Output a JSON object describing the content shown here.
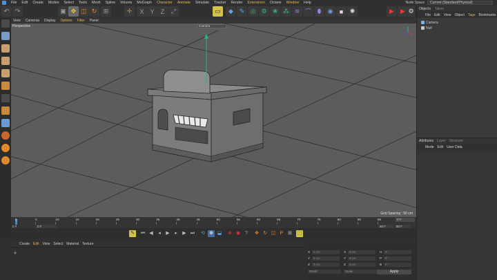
{
  "menubar": {
    "items": [
      "File",
      "Edit",
      "Create",
      "Modes",
      "Select",
      "Tools",
      "Mesh",
      "Spline",
      "Volume",
      "MoGraph",
      "Character",
      "Animate",
      "Simulate",
      "Tracker",
      "Render",
      "Extensions",
      "Octane",
      "Window",
      "Help"
    ],
    "node_space_label": "Node Space",
    "node_space_value": "Current (Standard/Physical)"
  },
  "viewport": {
    "menu": [
      "View",
      "Cameras",
      "Display",
      "Options",
      "Filter",
      "Panel"
    ],
    "label": "Perspective",
    "camera": "Camera",
    "grid_spacing": "Grid Spacing : 50 cm"
  },
  "timeline": {
    "ticks": [
      "0",
      "5",
      "10",
      "15",
      "20",
      "25",
      "30",
      "35",
      "40",
      "45",
      "50",
      "55",
      "60",
      "65",
      "70",
      "75",
      "80",
      "85",
      "90"
    ],
    "frame_right": "0 F",
    "start": "0 F",
    "current": "0 F",
    "end": "90 F",
    "end2": "90 F"
  },
  "material": {
    "menu": [
      "Create",
      "Edit",
      "View",
      "Select",
      "Material",
      "Texture"
    ],
    "add": "+"
  },
  "coordinates": {
    "labels": [
      "X",
      "Y",
      "Z",
      "X",
      "Y",
      "Z",
      "H",
      "P",
      "B"
    ],
    "values": [
      "0 cm",
      "0 cm",
      "0 cm",
      "0 cm",
      "0 cm",
      "0 cm",
      "0 °",
      "0 °",
      "0 °"
    ],
    "mode": "World",
    "scale": "Scale",
    "apply": "Apply"
  },
  "objects": {
    "tabs": [
      "Objects",
      "Takes"
    ],
    "menu": [
      "File",
      "Edit",
      "View",
      "Object",
      "Tags",
      "Bookmarks"
    ],
    "rows": [
      {
        "name": "Camera",
        "color": "#7fb3e6"
      },
      {
        "name": "Null",
        "color": "#c9c9c9"
      }
    ]
  },
  "attributes": {
    "tabs": [
      "Attributes",
      "Layer",
      "Structure"
    ],
    "menu": [
      "Mode",
      "Edit",
      "User Data"
    ]
  },
  "colors": {
    "accent": "#e6b84a",
    "viewport_bg": "#5c5c5c",
    "axis": "#2db37a"
  }
}
